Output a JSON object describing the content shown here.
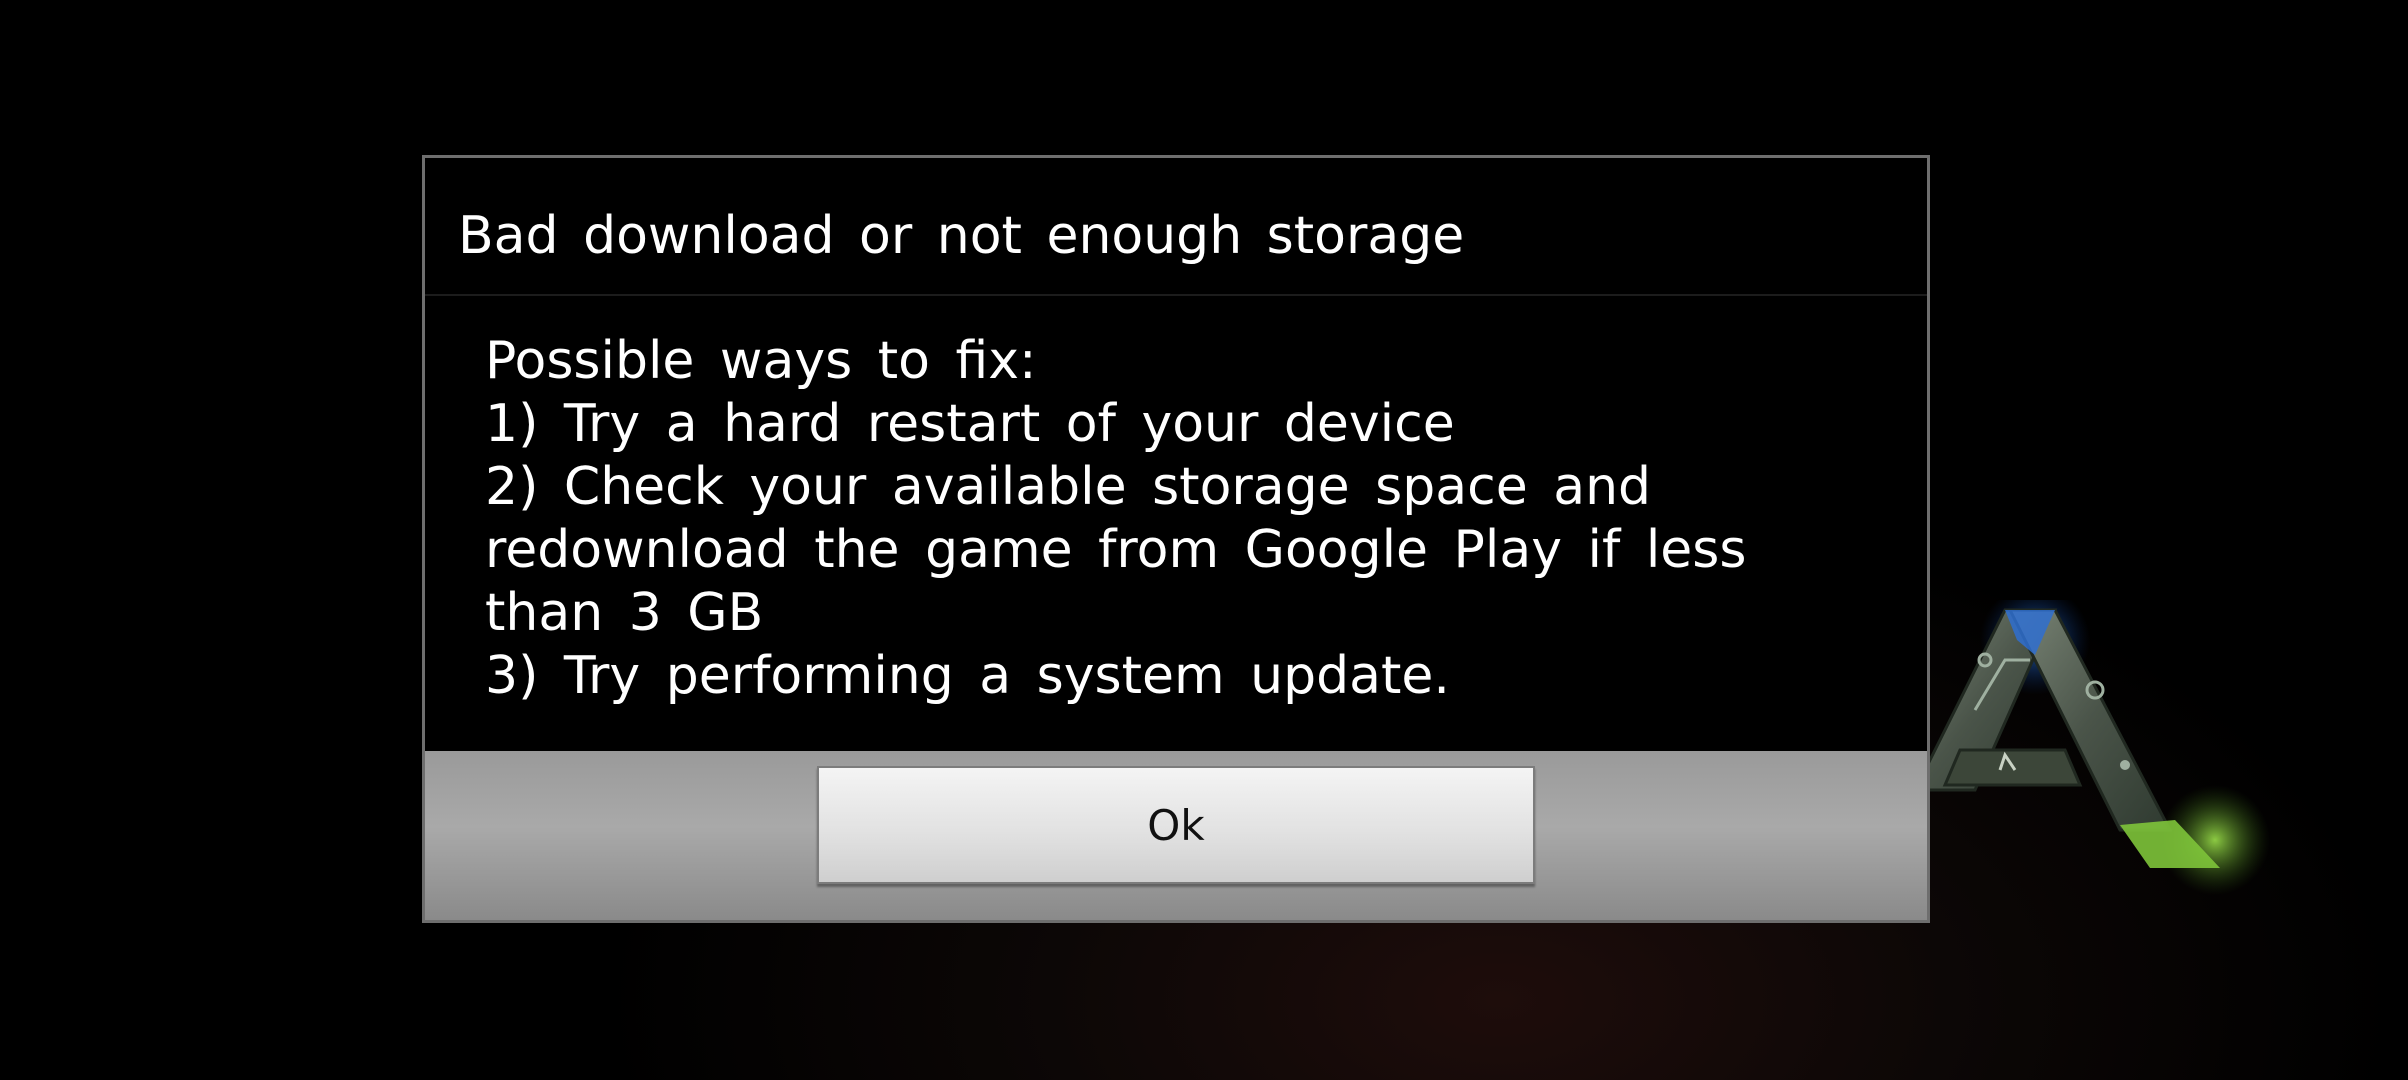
{
  "dialog": {
    "title": "Bad download or not enough storage",
    "message_lines": [
      "Possible ways to fix:",
      "1) Try a hard restart of your device",
      "2) Check your available storage space and",
      "redownload the game from Google Play if less",
      "than 3 GB",
      "3) Try performing a system update."
    ],
    "ok_label": "Ok"
  },
  "background": {
    "logo_icon": "ark-logo-icon",
    "colors": {
      "logo_blue": "#2f6fd0",
      "logo_green": "#7ec43a",
      "logo_stone": "#5f6a5c"
    }
  }
}
